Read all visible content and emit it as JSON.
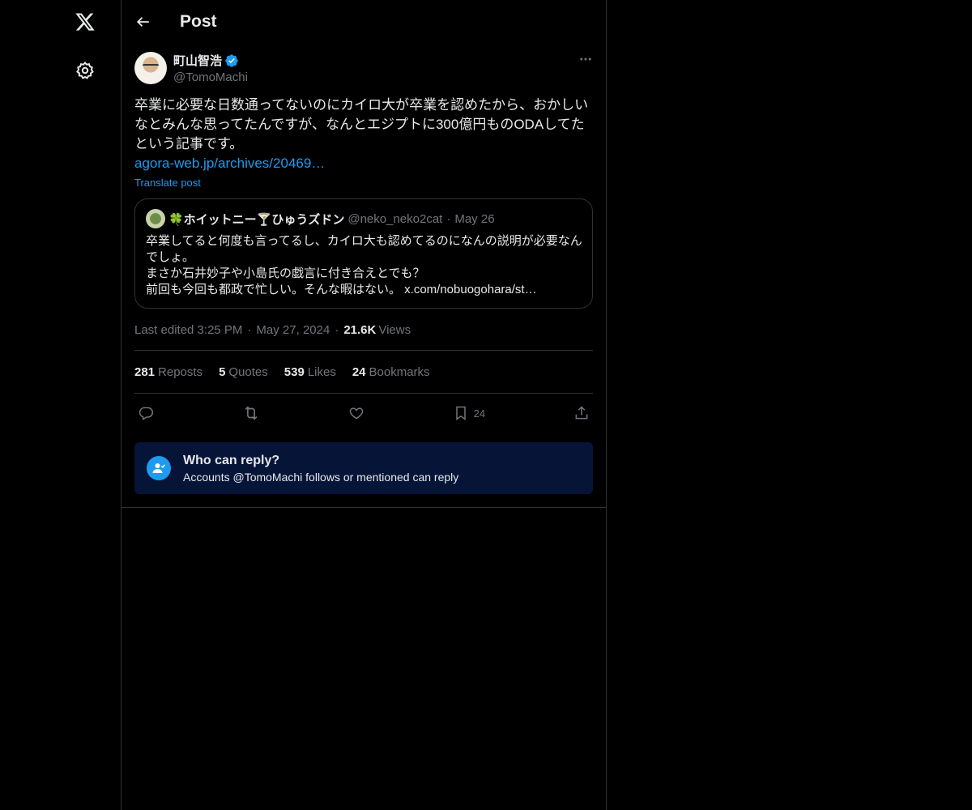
{
  "header": {
    "title": "Post"
  },
  "post": {
    "author_name": "町山智浩",
    "author_handle": "@TomoMachi",
    "text": "卒業に必要な日数通ってないのにカイロ大が卒業を認めたから、おかしいなとみんな思ってたんですが、なんとエジプトに300億円ものODAしてたという記事です。",
    "link_text": "agora-web.jp/archives/20469…",
    "translate_label": "Translate post"
  },
  "quote": {
    "name": "🍀ホイットニー🍸ひゅうズドン",
    "handle": "@neko_neko2cat",
    "separator": "·",
    "date": "May 26",
    "text": "卒業してると何度も言ってるし、カイロ大も認めてるのになんの説明が必要なんでしょ。\nまさか石井妙子や小島氏の戯言に付き合えとでも？\n前回も今回も都政で忙しい。そんな暇はない。 x.com/nobuogohara/st…"
  },
  "meta": {
    "edited": "Last edited 3:25 PM",
    "sep": "·",
    "date": "May 27, 2024",
    "views_count": "21.6K",
    "views_label": "Views"
  },
  "stats": [
    {
      "num": "281",
      "label": "Reposts"
    },
    {
      "num": "5",
      "label": "Quotes"
    },
    {
      "num": "539",
      "label": "Likes"
    },
    {
      "num": "24",
      "label": "Bookmarks"
    }
  ],
  "actions": {
    "bookmark_count": "24"
  },
  "reply_restriction": {
    "title": "Who can reply?",
    "subtitle": "Accounts @TomoMachi follows or mentioned can reply"
  },
  "colors": {
    "accent": "#1d9bf0",
    "background": "#000000",
    "reply_box": "#061438",
    "muted": "#71767b"
  }
}
